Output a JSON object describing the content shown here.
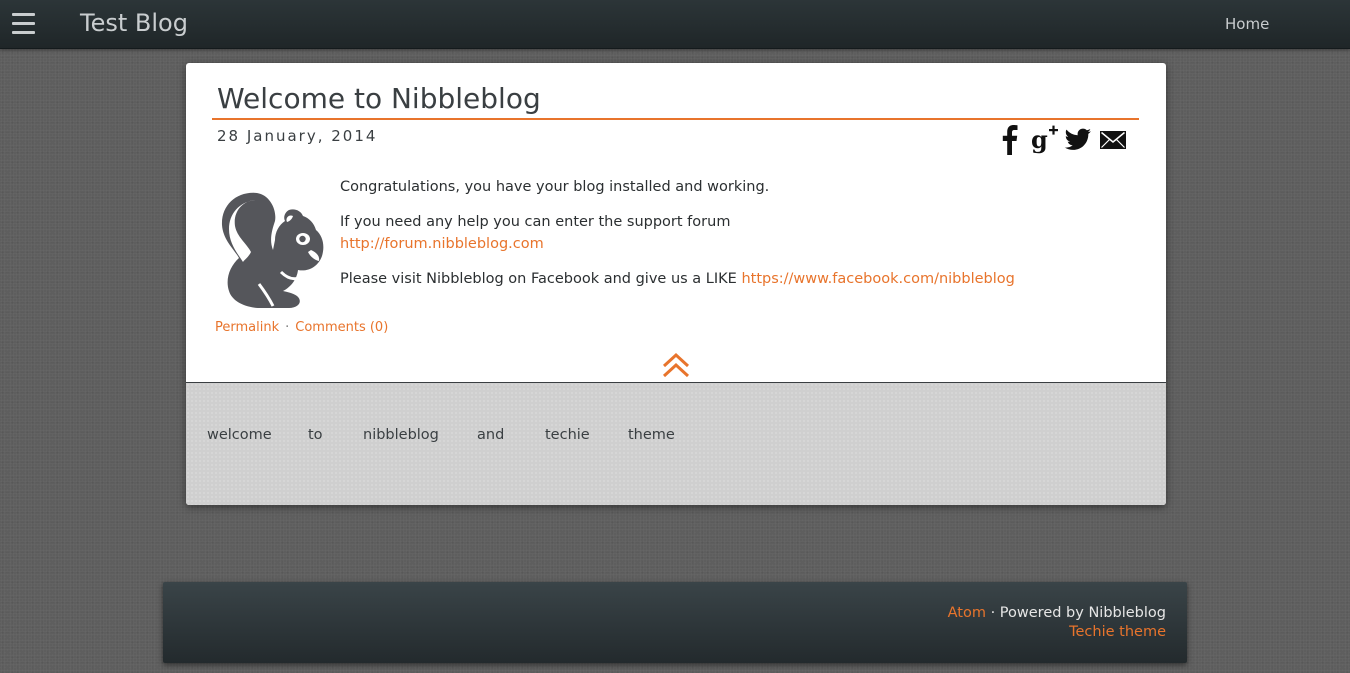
{
  "header": {
    "site_title": "Test Blog",
    "nav": {
      "home": "Home"
    }
  },
  "post": {
    "title": "Welcome to Nibbleblog",
    "date": "28 January, 2014",
    "share_icons": [
      "facebook-icon",
      "google-plus-icon",
      "twitter-icon",
      "email-icon"
    ],
    "body": {
      "p1": "Congratulations, you have your blog installed and working.",
      "p2_text": "If you need any help you can enter the support forum",
      "p2_link": "http://forum.nibbleblog.com",
      "p3_text": "Please visit Nibbleblog on Facebook and give us a LIKE",
      "p3_link": "https://www.facebook.com/nibbleblog"
    },
    "meta": {
      "permalink": "Permalink",
      "separator": "·",
      "comments": "Comments (0)"
    }
  },
  "tags": [
    "welcome",
    "to",
    "nibbleblog",
    "and",
    "techie",
    "theme"
  ],
  "footer": {
    "atom": "Atom",
    "powered": "· Powered by Nibbleblog",
    "theme": "Techie theme"
  },
  "colors": {
    "accent": "#e8742c",
    "topbar": "#263032",
    "page_bg": "#5e5e5e",
    "tags_bg": "#cfcfcf"
  }
}
